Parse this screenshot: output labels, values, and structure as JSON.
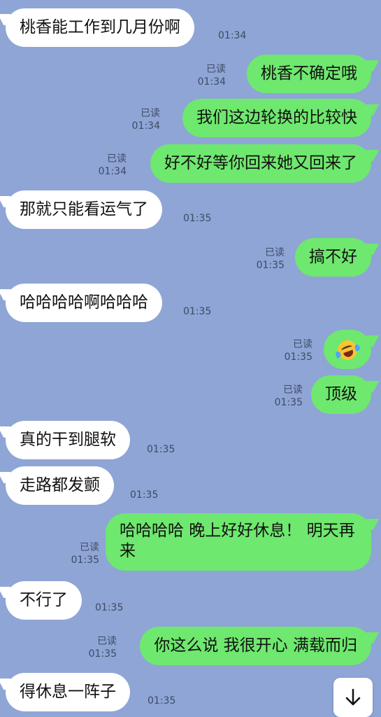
{
  "messages": [
    {
      "side": "in",
      "text": "桃香能工作到几月份啊",
      "time": "01:34"
    },
    {
      "side": "out",
      "text": "桃香不确定哦",
      "read": "已读",
      "time": "01:34"
    },
    {
      "side": "out",
      "text": "我们这边轮换的比较快",
      "read": "已读",
      "time": "01:34"
    },
    {
      "side": "out",
      "text": "好不好等你回来她又回来了",
      "read": "已读",
      "time": "01:34"
    },
    {
      "side": "in",
      "text": "那就只能看运气了",
      "time": "01:35"
    },
    {
      "side": "out",
      "text": "搞不好",
      "read": "已读",
      "time": "01:35"
    },
    {
      "side": "in",
      "text": "哈哈哈哈啊哈哈哈",
      "time": "01:35"
    },
    {
      "side": "out",
      "text": "",
      "emoji": "rolling-on-floor-laughing-emoji",
      "read": "已读",
      "time": "01:35"
    },
    {
      "side": "out",
      "text": "顶级",
      "read": "已读",
      "time": "01:35"
    },
    {
      "side": "in",
      "text": "真的干到腿软",
      "time": "01:35"
    },
    {
      "side": "in",
      "text": "走路都发颤",
      "time": "01:35"
    },
    {
      "side": "out",
      "text": "哈哈哈哈 晚上好好休息！ 明天再来",
      "read": "已读",
      "time": "01:35"
    },
    {
      "side": "in",
      "text": "不行了",
      "time": "01:35"
    },
    {
      "side": "out",
      "text": "你这么说 我很开心 满载而归",
      "read": "已读",
      "time": "01:35"
    },
    {
      "side": "in",
      "text": "得休息一阵子",
      "time": "01:35"
    }
  ],
  "scroll_button": {
    "icon": "arrow-down-icon"
  },
  "colors": {
    "background": "#8ea5d6",
    "incoming_bubble": "#ffffff",
    "outgoing_bubble": "#6ee86e"
  }
}
